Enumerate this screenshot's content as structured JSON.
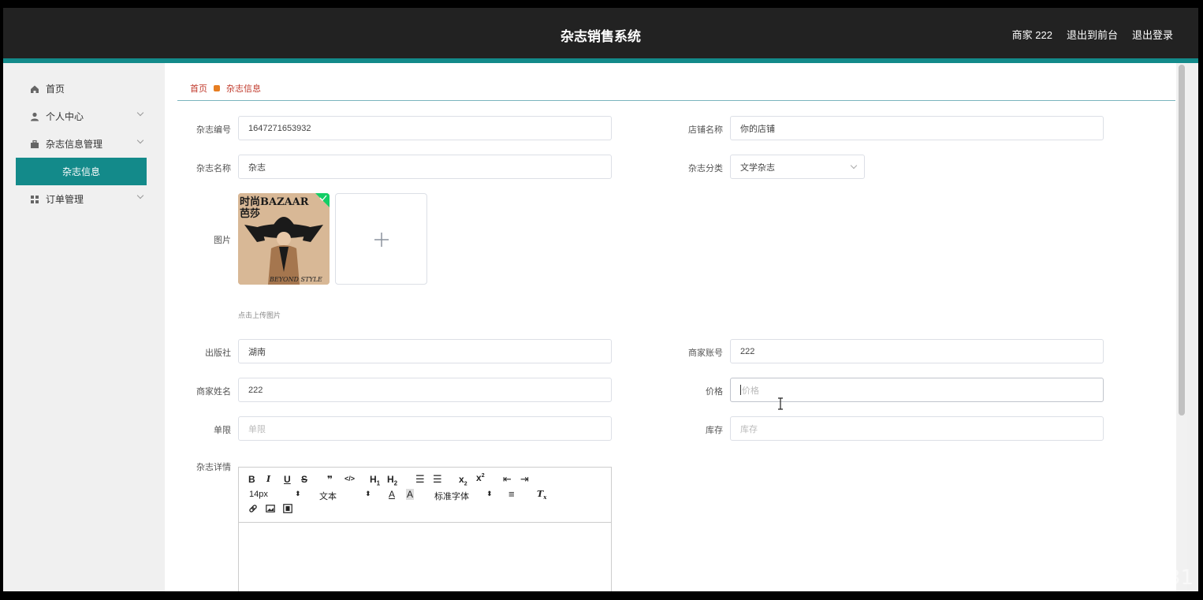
{
  "header": {
    "title": "杂志销售系统",
    "user_label": "商家 222",
    "front_label": "退出到前台",
    "logout_label": "退出登录"
  },
  "sidebar": {
    "items": [
      {
        "label": "首页",
        "icon": "home-icon"
      },
      {
        "label": "个人中心",
        "icon": "user-icon"
      },
      {
        "label": "杂志信息管理",
        "icon": "briefcase-icon"
      },
      {
        "label": "杂志信息",
        "icon": ""
      },
      {
        "label": "订单管理",
        "icon": "grid-icon"
      }
    ]
  },
  "breadcrumb": {
    "home": "首页",
    "current": "杂志信息"
  },
  "form": {
    "magazine_no_label": "杂志编号",
    "magazine_no_value": "1647271653932",
    "store_label": "店铺名称",
    "store_value": "你的店铺",
    "name_label": "杂志名称",
    "name_value": "杂志",
    "category_label": "杂志分类",
    "category_value": "文学杂志",
    "image_label": "图片",
    "upload_tip": "点击上传图片",
    "image_text": {
      "top": "时尚BAZAAR",
      "sub": "芭莎",
      "bottom": "BEYOND STYLE"
    },
    "publisher_label": "出版社",
    "publisher_value": "湖南",
    "merchant_account_label": "商家账号",
    "merchant_account_value": "222",
    "merchant_name_label": "商家姓名",
    "merchant_name_value": "222",
    "price_label": "价格",
    "price_placeholder": "价格",
    "limit_label": "单限",
    "limit_placeholder": "单限",
    "stock_label": "库存",
    "stock_placeholder": "库存",
    "details_label": "杂志详情"
  },
  "editor": {
    "font_size": "14px",
    "text_type": "文本",
    "font_family": "标准字体"
  },
  "watermark": "CSDN @CK3031",
  "colors": {
    "accent": "#138a8a",
    "topbar": "#222222",
    "breadcrumb": "#c0392b"
  }
}
